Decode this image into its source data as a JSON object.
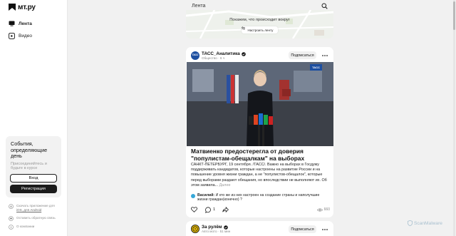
{
  "app": {
    "logo_text": "мт.ру"
  },
  "sidebar": {
    "items": [
      {
        "label": "Лента",
        "icon": "monitor-icon",
        "active": true
      },
      {
        "label": "Видео",
        "icon": "play-icon",
        "active": false
      }
    ],
    "promo": {
      "title": "События, определяющие день",
      "subtitle": "Присоединяйтесь и будьте в курсе",
      "login_label": "Вход",
      "register_label": "Регистрация"
    },
    "footer_links": [
      {
        "text": "Скачать приложение для",
        "link": "iOS, для Android",
        "icon": "download-icon"
      },
      {
        "text": "Оставить обратную связь",
        "icon": "chat-icon"
      },
      {
        "text": "О компании",
        "icon": "info-icon"
      }
    ]
  },
  "header": {
    "title": "Лента",
    "search_icon": "search-icon"
  },
  "map_card": {
    "caption": "Покажем, что происходит вокруг",
    "button_label": "Настроить ленту"
  },
  "post": {
    "source_name": "ТАСС_Аналитика",
    "avatar_text": "ТАСС",
    "category": "Общество",
    "time": "· 6 ч",
    "subscribe_label": "Подписаться",
    "photo_badge": "ТАСС",
    "title": "Матвиенко предостерегла от доверия \"популистам-обещалкам\" на выборах",
    "text": "САНКТ-ПЕТЕРБУРГ, 19 сентября. /ТАСС/. Важно на выборах в Госдуму поддерживать кандидатов, которые настроены на развитие России и на повышение уровня жизни граждан, а не \"популистов-обещалок\", которые перед выборами раздают обещания, но впоследствии не выполняют их. Об этом заявила...",
    "more_link": "Далее",
    "comment": {
      "author": "Василий:",
      "text": "И кто же из них настроен на создание страны и наполучшие жизни граждан(конечно) ?"
    },
    "comments_count": "1",
    "views": "660"
  },
  "post2": {
    "source_name": "За рулём",
    "category": "Авто мото",
    "time": "· 51 мин",
    "subscribe_label": "Подписаться"
  },
  "watermark": {
    "text": "ScanMalware"
  },
  "colors": {
    "accent_dark": "#1b1b1b",
    "tass_blue": "#1d4fa0",
    "muted": "#9a9a9a"
  }
}
